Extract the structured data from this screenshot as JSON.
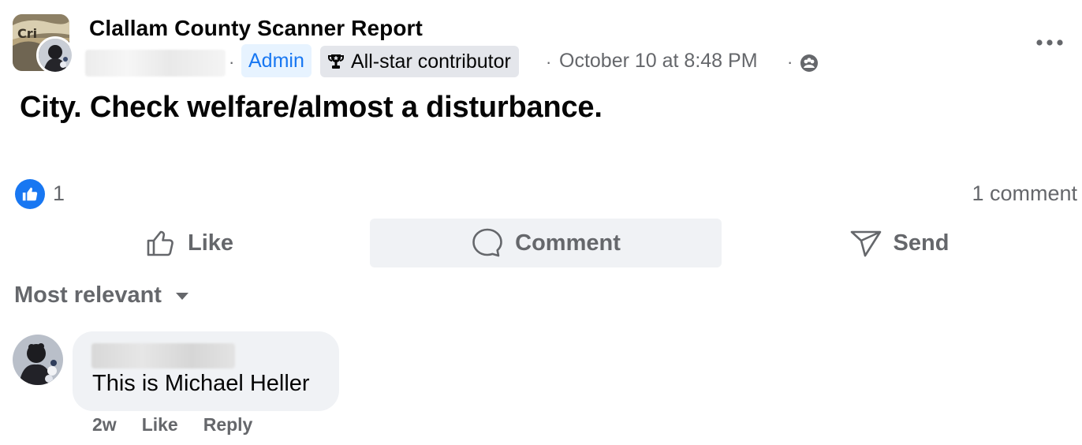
{
  "post": {
    "group_name": "Clallam County Scanner Report",
    "separator": "·",
    "admin_badge": "Admin",
    "allstar_badge": "All-star contributor",
    "timestamp": "October 10 at 8:48 PM",
    "privacy_icon": "group-members-icon",
    "body": "City. Check welfare/almost a disturbance.",
    "more_icon": "more-horizontal-icon"
  },
  "reactions": {
    "like_icon": "thumbs-up-reaction-icon",
    "like_count": "1",
    "comment_count": "1 comment"
  },
  "actions": {
    "like": "Like",
    "comment": "Comment",
    "send": "Send"
  },
  "comments_sort": {
    "label": "Most relevant",
    "icon": "caret-down-icon"
  },
  "comments": [
    {
      "text": "This is Michael Heller",
      "age": "2w",
      "like": "Like",
      "reply": "Reply"
    }
  ],
  "colors": {
    "accent": "#1877f2",
    "admin_bg": "#e7f3ff",
    "secondary_text": "#65676b",
    "bubble_bg": "#f0f2f5"
  }
}
